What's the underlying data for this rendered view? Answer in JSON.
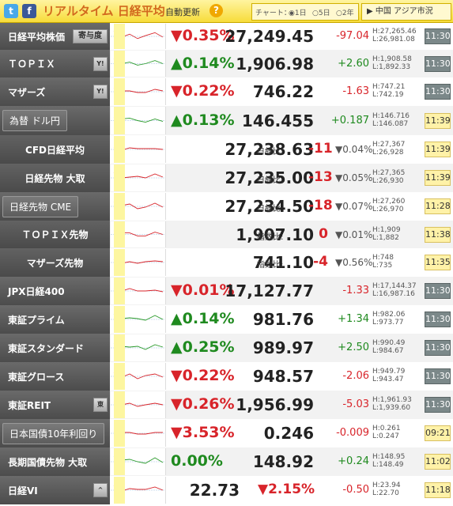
{
  "header": {
    "twitter": "t",
    "facebook": "f",
    "title": "リアルタイム 日経平均",
    "auto": "自動更新",
    "help": "?",
    "chart_label": "チャート：",
    "range": [
      "◉1日",
      "○5日",
      "○2年"
    ],
    "market_button": "▶ 中国 アジア市況"
  },
  "rows": [
    {
      "label": "日経平均株価",
      "btn": "寄与度",
      "pct": "0.35%",
      "dir": "dn",
      "price": "27,249.45",
      "chg": "-97.04",
      "cdir": "dn",
      "h": "H:27,265.46",
      "l": "L:26,981.08",
      "time": "11:30",
      "tc": "g"
    },
    {
      "label": "ＴＯＰＩＸ",
      "btn": "Y!",
      "pct": "0.14%",
      "dir": "up",
      "price": "1,906.98",
      "chg": "+2.60",
      "cdir": "up",
      "h": "H:1,908.58",
      "l": "L:1,892.33",
      "time": "11:30",
      "tc": "g"
    },
    {
      "label": "マザーズ",
      "btn": "Y!",
      "pct": "0.22%",
      "dir": "dn",
      "price": "746.22",
      "chg": "-1.63",
      "cdir": "dn",
      "h": "H:747.21",
      "l": "L:742.19",
      "time": "11:30",
      "tc": "g"
    },
    {
      "label": "為替 ドル円",
      "pct": "0.13%",
      "dir": "up",
      "price": "146.455",
      "chg": "+0.187",
      "cdir": "up",
      "h": "H:146.716",
      "l": "L:146.087",
      "time": "11:39",
      "tc": "y"
    },
    {
      "label": "CFD日経平均",
      "price": "27,238.63",
      "dlab": "日経比:",
      "dv": "-11",
      "dp": "0.04%",
      "h": "H:27,367",
      "l": "L:26,928",
      "time": "11:39",
      "tc": "y"
    },
    {
      "label": "日経先物 大取",
      "price": "27,235.00",
      "dlab": "日経比:",
      "dv": "-13",
      "dp": "0.05%",
      "h": "H:27,365",
      "l": "L:26,930",
      "time": "11:39",
      "tc": "y"
    },
    {
      "label": "日経先物 CME",
      "price": "27,234.50",
      "dlab": "日経比:",
      "dv": "-18",
      "dp": "0.07%",
      "h": "H:27,260",
      "l": "L:26,970",
      "time": "11:28",
      "tc": "y"
    },
    {
      "label": "ＴＯＰＩＸ先物",
      "price": "1,907.10",
      "dlab": "指数比:",
      "dv": "0",
      "dp": "0.01%",
      "h": "H:1,909",
      "l": "L:1,882",
      "time": "11:38",
      "tc": "y"
    },
    {
      "label": "マザーズ先物",
      "price": "741.10",
      "dlab": "指数比:",
      "dv": "-4",
      "dp": "0.56%",
      "h": "H:748",
      "l": "L:735",
      "time": "11:35",
      "tc": "y"
    },
    {
      "label": "JPX日経400",
      "pct": "0.01%",
      "dir": "dn",
      "price": "17,127.77",
      "chg": "-1.33",
      "cdir": "dn",
      "h": "H:17,144.37",
      "l": "L:16,987.16",
      "time": "11:30",
      "tc": "g"
    },
    {
      "label": "東証プライム",
      "pct": "0.14%",
      "dir": "up",
      "price": "981.76",
      "chg": "+1.34",
      "cdir": "up",
      "h": "H:982.06",
      "l": "L:973.77",
      "time": "11:30",
      "tc": "g"
    },
    {
      "label": "東証スタンダード",
      "pct": "0.25%",
      "dir": "up",
      "price": "989.97",
      "chg": "+2.50",
      "cdir": "up",
      "h": "H:990.49",
      "l": "L:984.67",
      "time": "11:30",
      "tc": "g"
    },
    {
      "label": "東証グロース",
      "pct": "0.22%",
      "dir": "dn",
      "price": "948.57",
      "chg": "-2.06",
      "cdir": "dn",
      "h": "H:949.79",
      "l": "L:943.47",
      "time": "11:30",
      "tc": "g"
    },
    {
      "label": "東証REIT",
      "btn": "東",
      "pct": "0.26%",
      "dir": "dn",
      "price": "1,956.99",
      "chg": "-5.03",
      "cdir": "dn",
      "h": "H:1,961.93",
      "l": "L:1,939.60",
      "time": "11:30",
      "tc": "g"
    },
    {
      "label": "日本国債10年利回り",
      "pct": "3.53%",
      "dir": "dn",
      "price": "0.246",
      "chg": "-0.009",
      "cdir": "dn",
      "h": "H:0.261",
      "l": "L:0.247",
      "time": "09:21",
      "tc": "y"
    },
    {
      "label": "長期国債先物 大取",
      "pct": "0.00%",
      "dir": "up0",
      "price": "148.92",
      "chg": "+0.24",
      "cdir": "up",
      "h": "H:148.95",
      "l": "L:148.49",
      "time": "11:02",
      "tc": "y"
    },
    {
      "label": "日経VI",
      "btn": "^",
      "price": "22.73",
      "bigpct": "2.15%",
      "chg": "-0.50",
      "cdir": "dn",
      "h": "H:23.94",
      "l": "L:22.70",
      "time": "11:18",
      "tc": "y"
    }
  ]
}
